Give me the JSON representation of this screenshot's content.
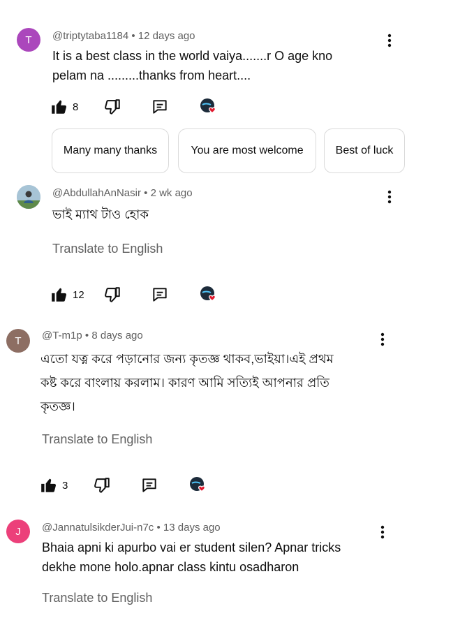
{
  "comments": [
    {
      "avatar_letter": "T",
      "avatar_color": "#ab47bc",
      "author": "@triptytaba1184",
      "time": "12 days ago",
      "text": "It is a best class in the world vaiya.......r O age kno\npelam na .........thanks from heart....",
      "likes": "8",
      "suggested_replies": [
        "Many many thanks",
        "You are most welcome",
        "Best of luck"
      ]
    },
    {
      "avatar_letter": "",
      "avatar_color": "#9bb7c8",
      "author": "@AbdullahAnNasir",
      "time": "2 wk ago",
      "text": "ভাই ম্যাথ টাও হোক",
      "translate": "Translate to English",
      "likes": "12"
    },
    {
      "avatar_letter": "T",
      "avatar_color": "#8d6e63",
      "author": "@T-m1p",
      "time": "8 days ago",
      "text": "এতো যত্ন করে পড়ানোর জন্য কৃতজ্ঞ থাকব,ভাইয়া।এই প্রথম\nকষ্ট করে বাংলায়  করলাম।   কারণ আমি সত্যিই আপনার প্রতি\nকৃতজ্ঞ।",
      "translate": "Translate to English",
      "likes": "3"
    },
    {
      "avatar_letter": "J",
      "avatar_color": "#ec407a",
      "author": "@JannatulsikderJui-n7c",
      "time": "13 days ago",
      "text": "Bhaia apni ki apurbo vai er student silen?  Apnar tricks\ndekhe mone holo.apnar class kintu osadharon",
      "translate": "Translate to English"
    }
  ],
  "icons": {
    "like": "thumb-up-icon",
    "dislike": "thumb-down-icon",
    "reply": "reply-comment-icon",
    "creator_heart": "creator-heart-icon",
    "more": "more-vertical-icon"
  },
  "colors": {
    "heart": "#e0182d",
    "secondary_text": "#606060"
  }
}
